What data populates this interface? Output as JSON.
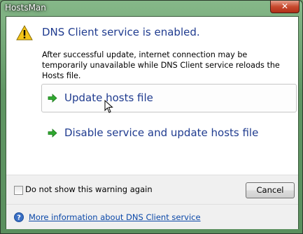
{
  "window": {
    "title": "HostsMan",
    "close_glyph": "✕"
  },
  "dialog": {
    "headline": "DNS Client service is enabled.",
    "description": "After successful update, internet connection may be temporarily unavailable while DNS Client service reloads the Hosts file.",
    "commands": [
      {
        "label": "Update hosts file",
        "icon": "green-arrow-icon",
        "state": "hover"
      },
      {
        "label": "Disable service and update hosts file",
        "icon": "green-arrow-icon",
        "state": "normal"
      }
    ],
    "checkbox": {
      "label": "Do not show this warning again",
      "checked": false
    },
    "cancel_label": "Cancel",
    "more_info_link": "More information about DNS Client service"
  },
  "colors": {
    "heading_blue": "#1f3b8f",
    "link_blue": "#0b48a8",
    "arrow_green": "#2fa82f",
    "warning_yellow": "#f5c518"
  }
}
